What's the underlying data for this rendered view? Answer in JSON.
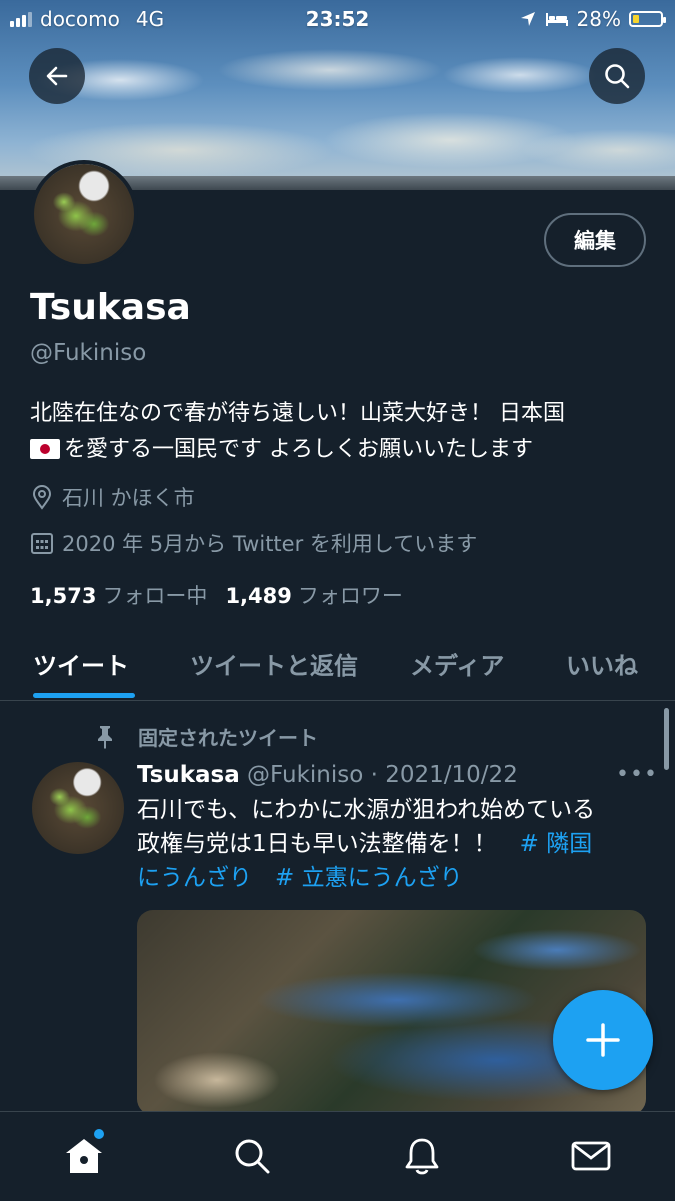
{
  "status_bar": {
    "carrier": "docomo",
    "network": "4G",
    "time": "23:52",
    "battery": "28%"
  },
  "header": {
    "back_icon": "arrow-left-icon",
    "search_icon": "search-icon"
  },
  "profile": {
    "display_name": "Tsukasa",
    "handle": "@Fukiniso",
    "edit_label": "編集",
    "bio_line1": "北陸在住なので春が待ち遠しい！山菜大好き！ 日本国",
    "bio_line2": "を愛する一国民です よろしくお願いいたします",
    "location": "石川 かほく市",
    "joined": "2020 年 5月から Twitter を利用しています",
    "following_count": "1,573",
    "following_label": "フォロー中",
    "followers_count": "1,489",
    "followers_label": "フォロワー"
  },
  "tabs": [
    {
      "label": "ツイート",
      "active": true
    },
    {
      "label": "ツイートと返信",
      "active": false
    },
    {
      "label": "メディア",
      "active": false
    },
    {
      "label": "いいね",
      "active": false
    }
  ],
  "pinned_tweet": {
    "pinned_label": "固定されたツイート",
    "name": "Tsukasa",
    "handle_date": "@Fukiniso · 2021/10/22",
    "line1": "石川でも、にわかに水源が狙われ始めている",
    "line2": "政権与党は1日も早い法整備を！！　",
    "hashtag1_a": "# 隣国",
    "hashtag1_b": "にうんざり",
    "hashtag2": "# 立憲にうんざり"
  },
  "bottom_nav": {
    "items": [
      "home-icon",
      "search-icon",
      "bell-icon",
      "mail-icon"
    ]
  },
  "colors": {
    "background": "#15202b",
    "accent": "#1da1f2",
    "secondary_text": "#8899a6"
  }
}
